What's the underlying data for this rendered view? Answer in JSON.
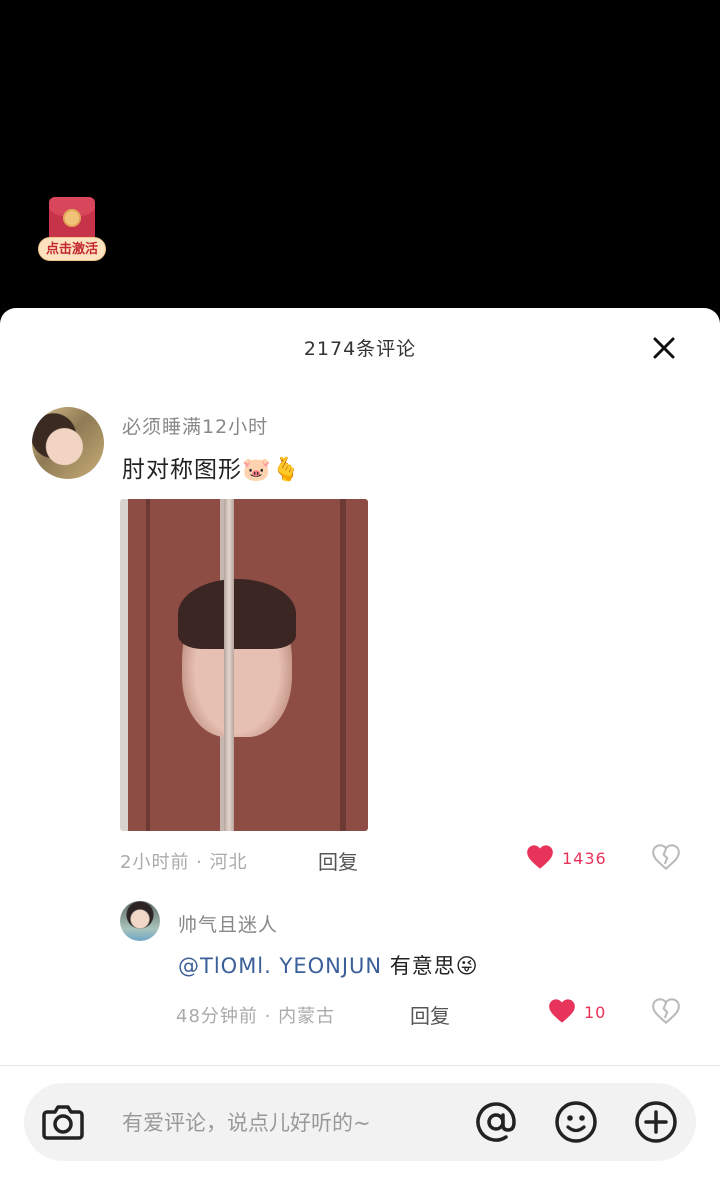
{
  "banner": {
    "activate_label": "点击激活",
    "icon": "red-envelope-icon"
  },
  "comments_panel": {
    "title": "2174条评论",
    "close_icon": "close-icon"
  },
  "comment": {
    "username": "必须睡满12小时",
    "text": "肘对称图形🐷🫰",
    "image_alt": "symmetrical face photo",
    "time_location": "2小时前 · 河北",
    "reply_label": "回复",
    "like_count": "1436",
    "like_color": "#e8335a"
  },
  "reply": {
    "username": "帅气且迷人",
    "mention": "@TlOMl. YEONJUN",
    "text": " 有意思😜",
    "time_location": "48分钟前 · 内蒙古",
    "reply_label": "回复",
    "like_count": "10"
  },
  "input_bar": {
    "placeholder": "有爱评论，说点儿好听的~",
    "camera_icon": "camera-icon",
    "at_icon": "at-icon",
    "emoji_icon": "emoji-icon",
    "plus_icon": "plus-icon"
  }
}
